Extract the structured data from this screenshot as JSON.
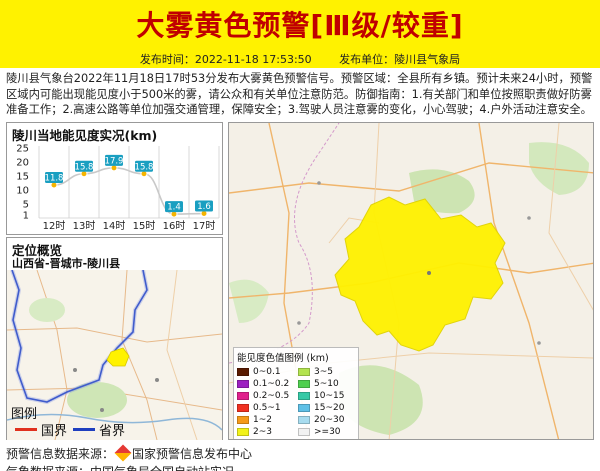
{
  "header": {
    "title": "大雾黄色预警[Ⅲ级/较重]",
    "publish_time_label": "发布时间：2022-11-18 17:53:50",
    "publisher_label": "发布单位：陵川县气象局",
    "bg_color": "#fff200",
    "title_color": "#c00000"
  },
  "description": "陵川县气象台2022年11月18日17时53分发布大雾黄色预警信号。预警区域：全县所有乡镇。预计未来24小时，预警区域内可能出现能见度小于500米的雾，请公众和有关单位注意防范。防御指南：1.有关部门和单位按照职责做好防雾准备工作；2.高速公路等单位加强交通管理，保障安全；3.驾驶人员注意雾的变化，小心驾驶；4.户外活动注意安全。",
  "visibility_panel": {
    "title": "陵川当地能见度实况(km)",
    "y_ticks": [
      "25",
      "20",
      "15",
      "10",
      "5",
      "1"
    ],
    "hours": [
      "12时",
      "13时",
      "14时",
      "15时",
      "16时",
      "17时"
    ],
    "values": [
      "11.8",
      "15.8",
      "17.9",
      "15.8",
      "1.4",
      "1.6"
    ],
    "badge_color": "#1a9fc1"
  },
  "chart_data": {
    "type": "line",
    "title": "陵川当地能见度实况(km)",
    "categories": [
      "12时",
      "13时",
      "14时",
      "15时",
      "16时",
      "17时"
    ],
    "series": [
      {
        "values": [
          11.8,
          15.8,
          17.9,
          15.8,
          1.4,
          1.6
        ]
      }
    ],
    "y_ticks": [
      25,
      20,
      15,
      10,
      5,
      1
    ],
    "ylim": [
      0,
      25
    ],
    "grid": true
  },
  "location_panel": {
    "title": "定位概览",
    "subtitle": "山西省-晋城市-陵川县",
    "legend_title": "图例",
    "legend_items": [
      {
        "label": "国界",
        "color": "#e0301e"
      },
      {
        "label": "省界",
        "color": "#1f3fbf"
      }
    ]
  },
  "map_legend": {
    "title": "能见度色值图例 (km)",
    "items": [
      {
        "label": "0~0.1",
        "color": "#5a1a00"
      },
      {
        "label": "3~5",
        "color": "#b3e34f"
      },
      {
        "label": "0.1~0.2",
        "color": "#9c1fc0"
      },
      {
        "label": "5~10",
        "color": "#4fcf4f"
      },
      {
        "label": "0.2~0.5",
        "color": "#e0208c"
      },
      {
        "label": "10~15",
        "color": "#36c9a6"
      },
      {
        "label": "0.5~1",
        "color": "#f03020"
      },
      {
        "label": "15~20",
        "color": "#5fc0e6"
      },
      {
        "label": "1~2",
        "color": "#f59a1a"
      },
      {
        "label": "20~30",
        "color": "#a8dcef"
      },
      {
        "label": "2~3",
        "color": "#f2f21a"
      },
      {
        "label": ">=30",
        "color": "#f2f2f2"
      }
    ]
  },
  "footer": {
    "source_prefix": "预警信息数据来源：",
    "source_name": "国家预警信息发布中心",
    "line2": "气象数据来源：中国气象局全国自动站实况"
  }
}
